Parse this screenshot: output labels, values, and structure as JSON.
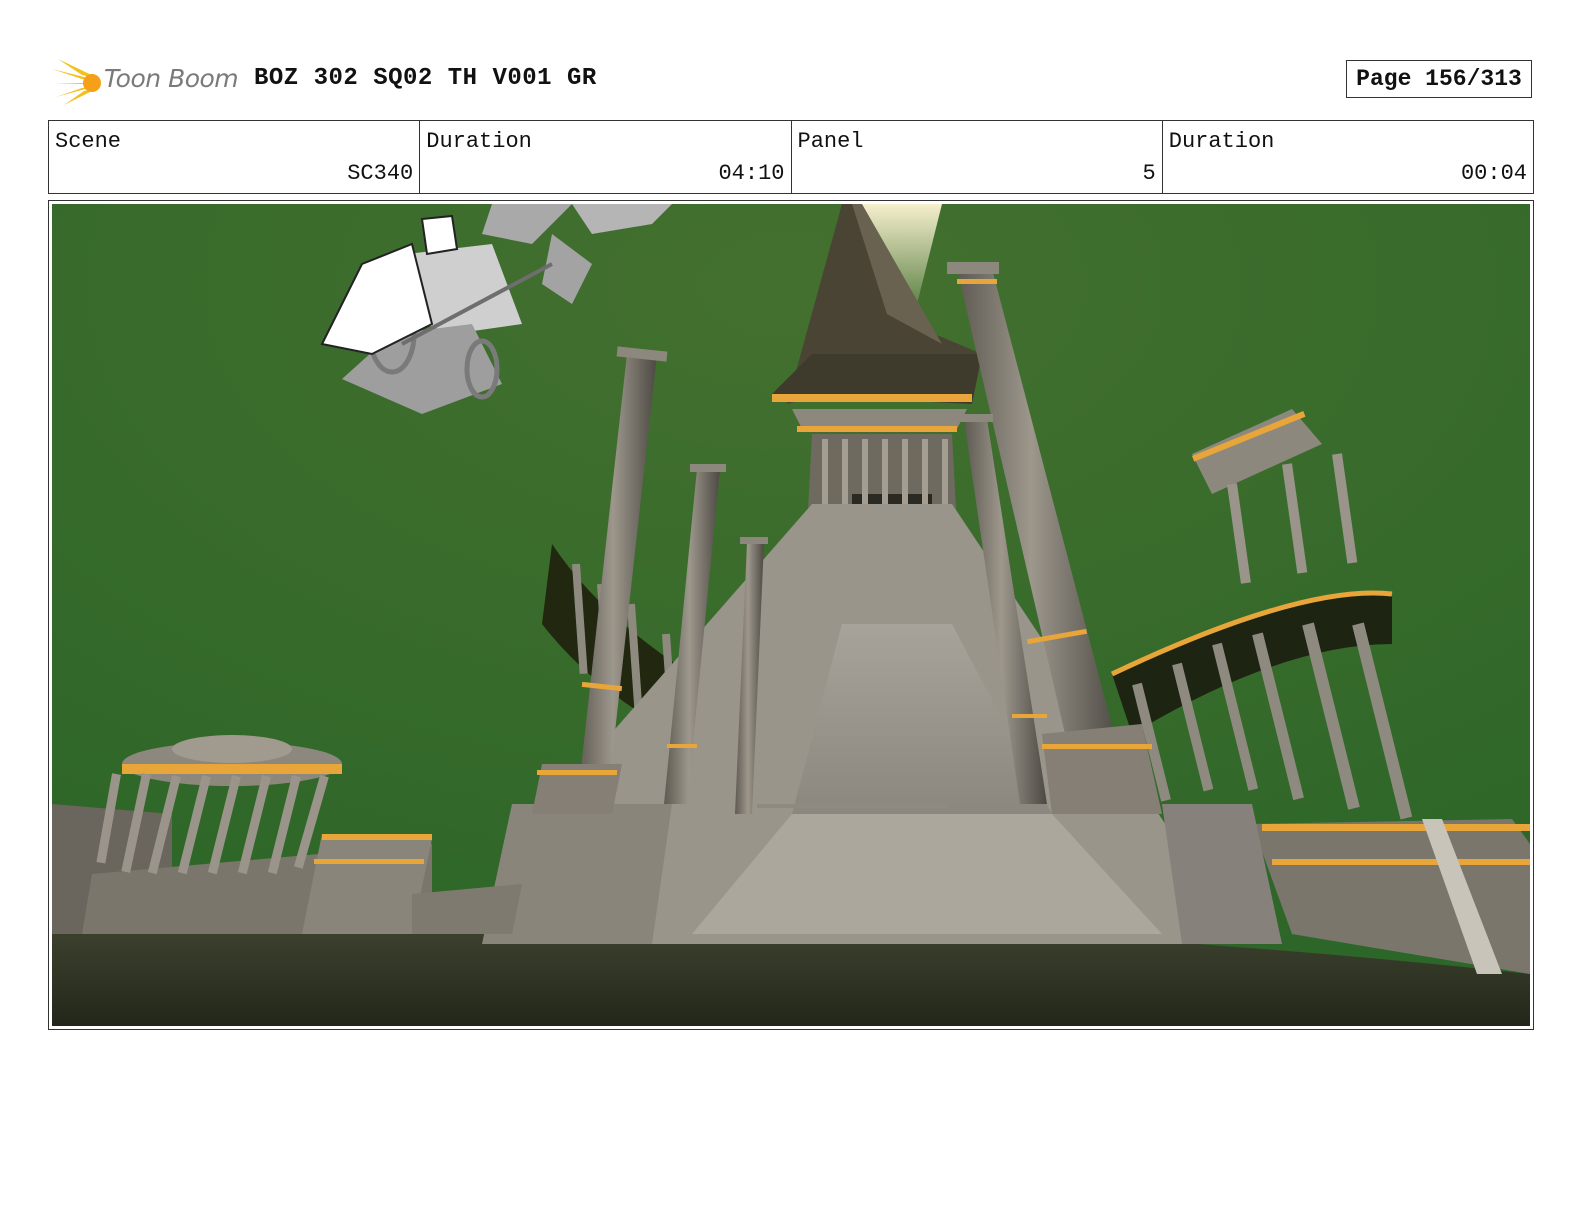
{
  "header": {
    "logo_text": "Toon Boom",
    "title": "BOZ 302 SQ02 TH V001 GR",
    "page": "Page 156/313"
  },
  "info": [
    {
      "label": "Scene",
      "value": "SC340"
    },
    {
      "label": "Duration",
      "value": "04:10"
    },
    {
      "label": "Panel",
      "value": "5"
    },
    {
      "label": "Duration",
      "value": "00:04"
    }
  ],
  "colors": {
    "sky": "#336b2c",
    "stone": "#8f8a82",
    "gold_trim": "#e8a53a",
    "ground": "#2e3220"
  },
  "icons": [
    "toon-boom-logo-icon"
  ]
}
